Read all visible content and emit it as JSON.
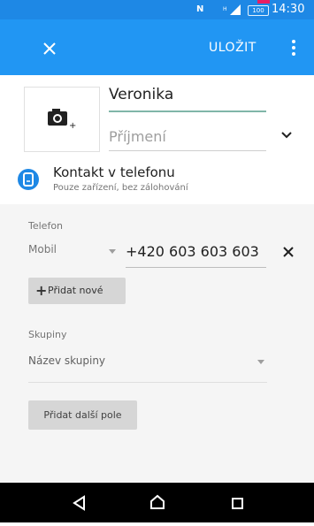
{
  "status_bar": {
    "time": "14:30",
    "battery": "100",
    "nfc_icon": "nfc-icon",
    "signal_icon": "signal-icon",
    "background_color": "#1e88e5"
  },
  "app_bar": {
    "close_icon": "close-icon",
    "save_label": "ULOŽIT",
    "menu_icon": "more-vert-icon",
    "background_color": "#2196f3"
  },
  "contact": {
    "photo_icon": "add-photo-icon",
    "first_name_value": "Veronika",
    "last_name_placeholder": "Příjmení",
    "expand_icon": "chevron-down-icon"
  },
  "account": {
    "icon": "phone-account-icon",
    "title": "Kontakt v telefonu",
    "subtitle": "Pouze zařízení, bez zálohování"
  },
  "phone_section": {
    "label": "Telefon",
    "type": "Mobil",
    "number": "+420 603 603 603",
    "remove_icon": "close-icon",
    "add_new_label": "Přidat nové",
    "add_icon": "plus-icon"
  },
  "groups_section": {
    "label": "Skupiny",
    "placeholder": "Název skupiny"
  },
  "add_field_label": "Přidat další pole",
  "nav_bar": {
    "back_icon": "back-icon",
    "home_icon": "home-icon",
    "recents_icon": "recents-icon"
  }
}
